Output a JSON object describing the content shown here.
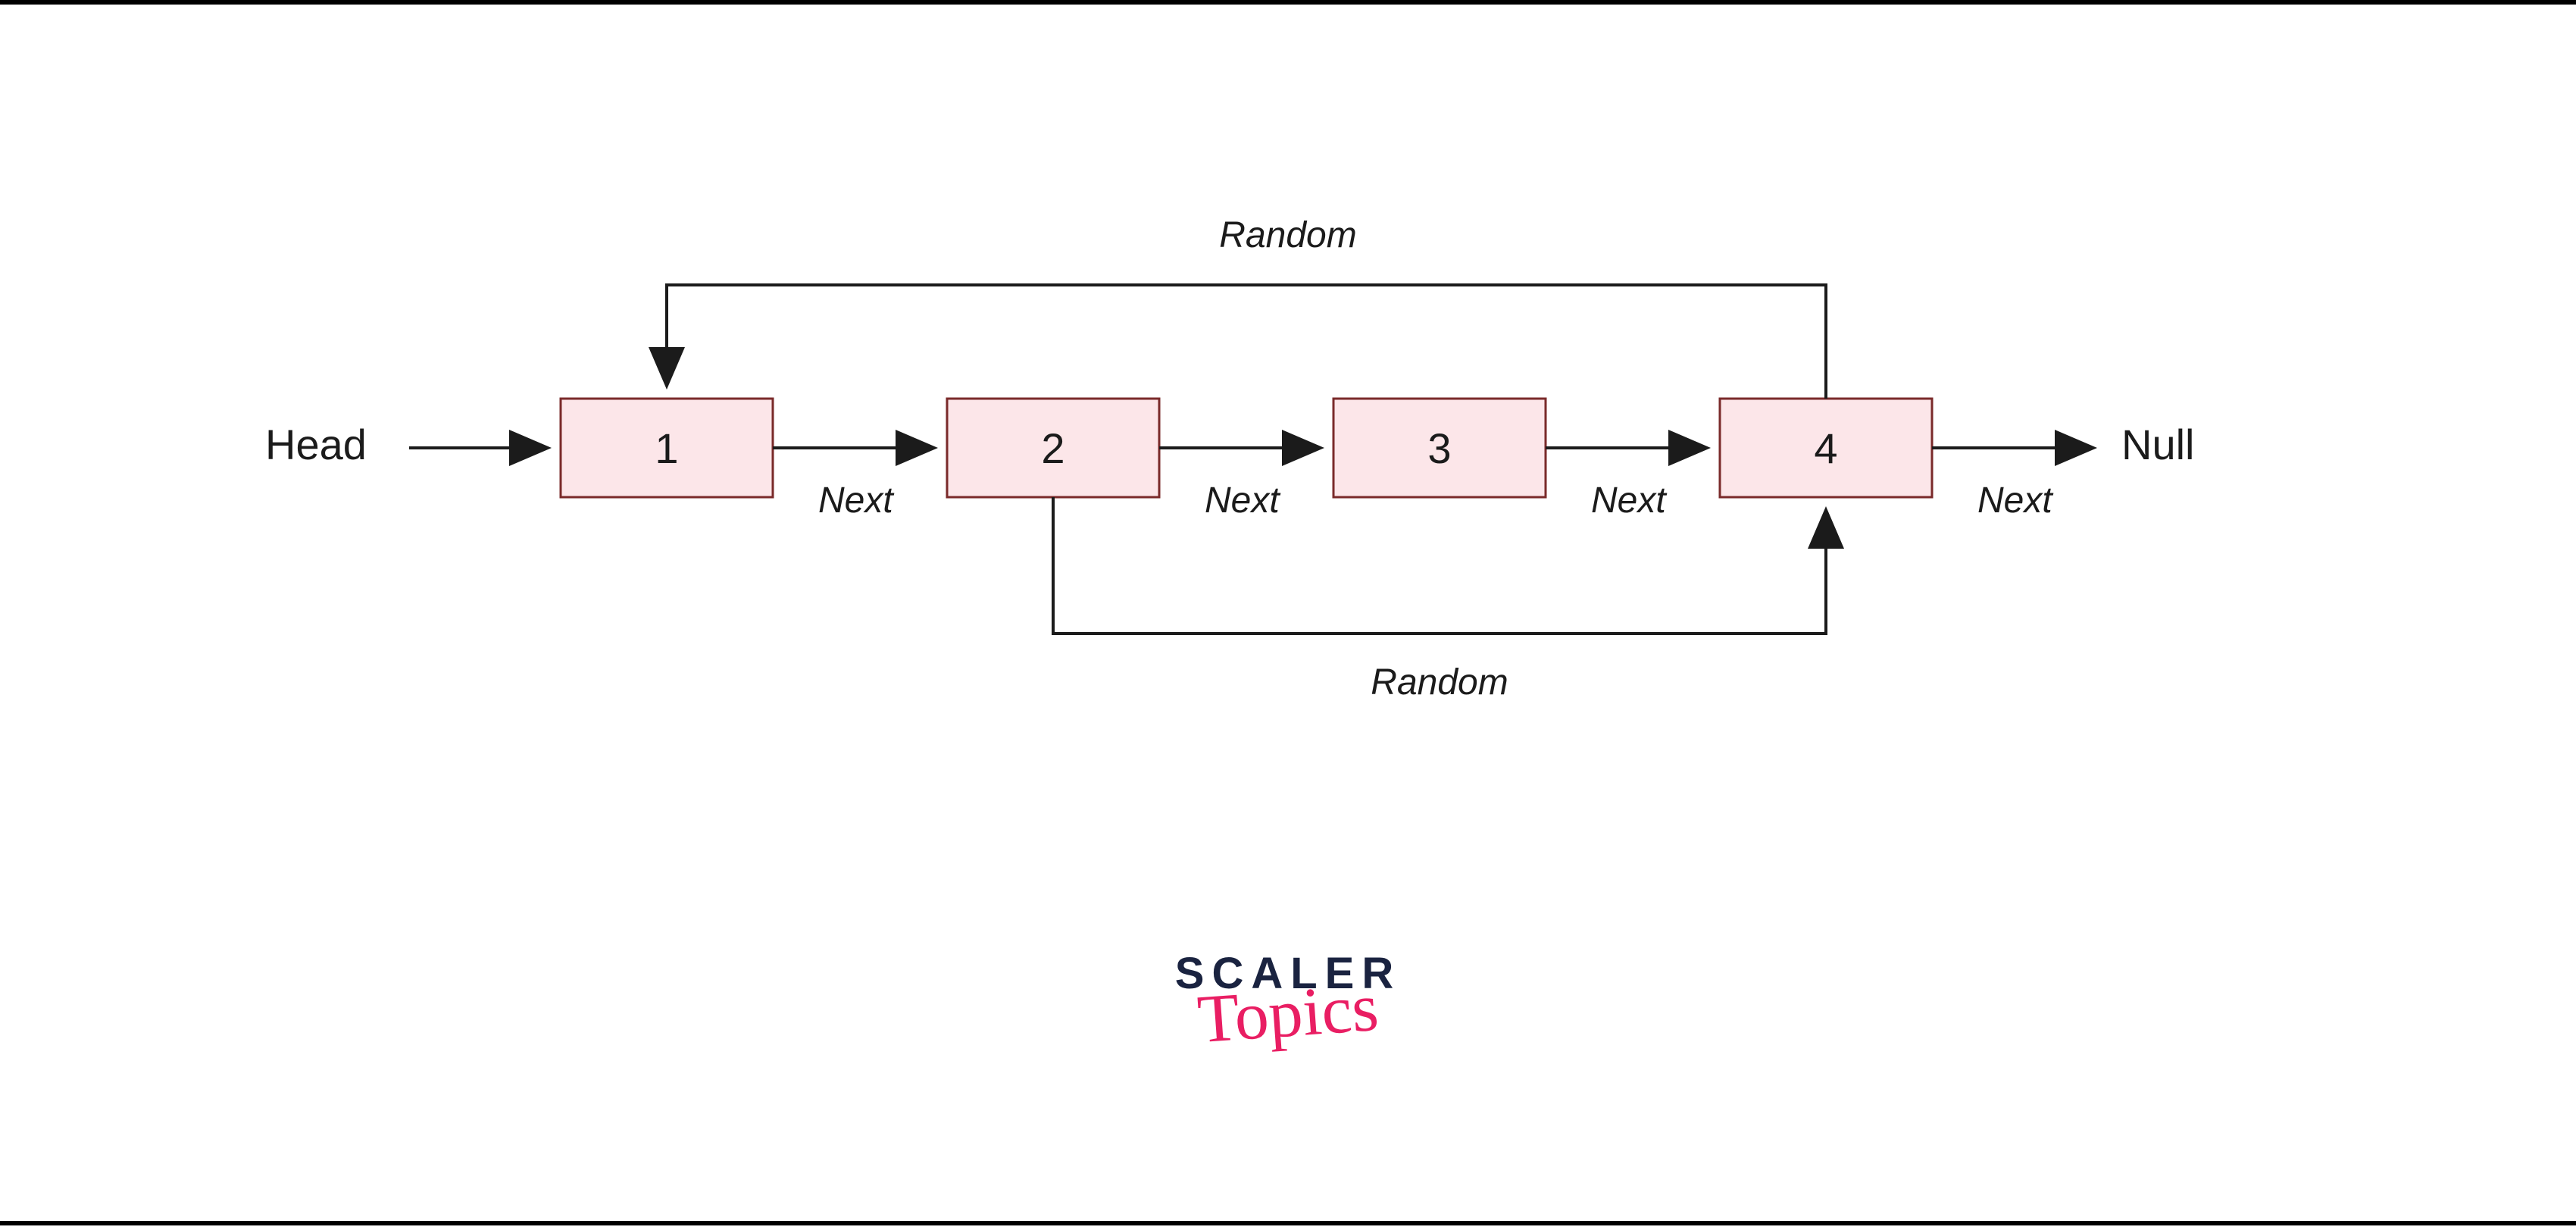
{
  "diagram": {
    "headLabel": "Head",
    "nullLabel": "Null",
    "nextLabel": "Next",
    "randomLabel": "Random",
    "nodes": [
      {
        "value": "1"
      },
      {
        "value": "2"
      },
      {
        "value": "3"
      },
      {
        "value": "4"
      }
    ],
    "randomPointers": [
      {
        "from": 4,
        "to": 1,
        "position": "top"
      },
      {
        "from": 2,
        "to": 4,
        "position": "bottom"
      }
    ]
  },
  "branding": {
    "top": "SCALER",
    "bottom": "Topics"
  },
  "colors": {
    "nodeFill": "#fce6e9",
    "nodeStroke": "#7a2a2a",
    "text": "#1b1b1b",
    "logoTop": "#1a2340",
    "logoBottom": "#e91e63"
  }
}
